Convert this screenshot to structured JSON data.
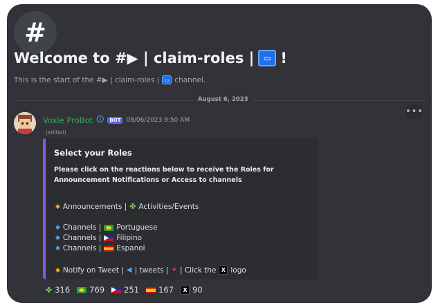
{
  "channel": {
    "hash_symbol": "#",
    "welcome_prefix": "Welcome to #▶ | claim-roles |",
    "welcome_suffix": "!",
    "start_prefix": "This is the start of the #▶ | claim-roles |",
    "start_suffix": "channel."
  },
  "date_divider": "August 6, 2023",
  "message": {
    "username": "Voxie ProBot",
    "bot_tag": "BOT",
    "timestamp": "08/06/2023 9:50 AM",
    "edited": "(edited)",
    "embed": {
      "accent_color": "#8c54e8",
      "title": "Select your Roles",
      "description": "Please click on the reactions below to receive the Roles for Announcement Notifications or Access to channels",
      "announcements": "Announcements |",
      "activities": "Activities/Events",
      "channels_prefix": "Channels |",
      "portuguese": "Portuguese",
      "filipino": "Filipino",
      "espanol": "Espanol",
      "notify_prefix": "Notify on Tweet |",
      "tweets": "| tweets |",
      "click_the": "| Click the",
      "logo": "logo"
    }
  },
  "reactions": [
    {
      "icon": "puzzle-icon",
      "count": "316"
    },
    {
      "icon": "brazil-flag-icon",
      "count": "769"
    },
    {
      "icon": "philippines-flag-icon",
      "count": "251"
    },
    {
      "icon": "spain-flag-icon",
      "count": "167"
    },
    {
      "icon": "x-logo-icon",
      "count": "90"
    }
  ]
}
